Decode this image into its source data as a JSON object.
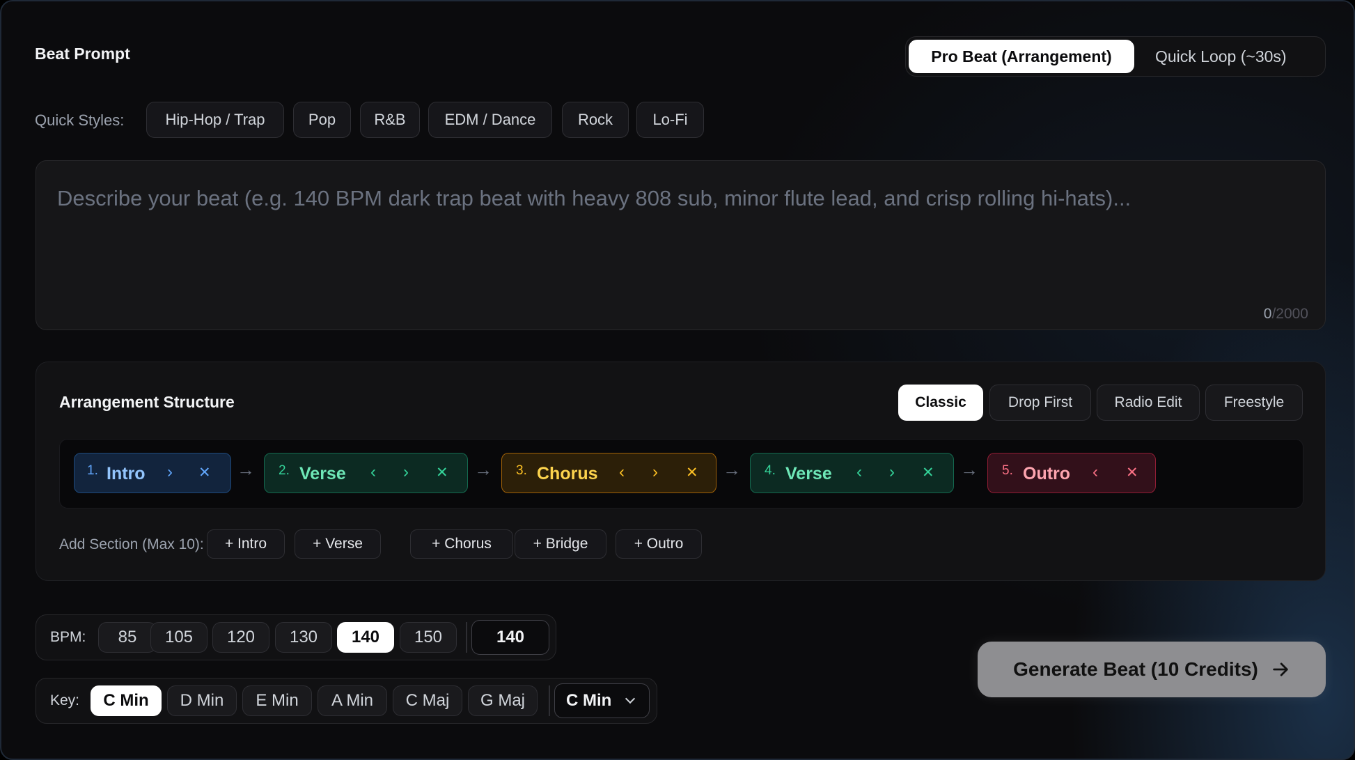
{
  "header": {
    "title": "Beat Prompt",
    "modes": [
      {
        "label": "Pro Beat (Arrangement)",
        "active": true
      },
      {
        "label": "Quick Loop (~30s)",
        "active": false
      }
    ]
  },
  "quick_styles": {
    "label": "Quick Styles:",
    "items": [
      "Hip-Hop / Trap",
      "Pop",
      "R&B",
      "EDM / Dance",
      "Rock",
      "Lo-Fi"
    ]
  },
  "prompt": {
    "placeholder": "Describe your beat (e.g. 140 BPM dark trap beat with heavy 808 sub, minor flute lead, and crisp rolling hi-hats)...",
    "count_current": "0",
    "count_max": "/2000"
  },
  "arrangement": {
    "title": "Arrangement Structure",
    "presets": [
      {
        "label": "Classic",
        "active": true
      },
      {
        "label": "Drop First",
        "active": false
      },
      {
        "label": "Radio Edit",
        "active": false
      },
      {
        "label": "Freestyle",
        "active": false
      }
    ],
    "sections": [
      {
        "num": "1.",
        "name": "Intro",
        "color": "blue"
      },
      {
        "num": "2.",
        "name": "Verse",
        "color": "green"
      },
      {
        "num": "3.",
        "name": "Chorus",
        "color": "yellow"
      },
      {
        "num": "4.",
        "name": "Verse",
        "color": "green"
      },
      {
        "num": "5.",
        "name": "Outro",
        "color": "red"
      }
    ],
    "glyphs": {
      "prev": "‹",
      "next": "›",
      "remove": "✕",
      "flow": "→"
    },
    "add_label": "Add Section (Max 10):",
    "add_buttons": [
      "+ Intro",
      "+ Verse",
      "+ Chorus",
      "+ Bridge",
      "+ Outro"
    ]
  },
  "bpm": {
    "label": "BPM:",
    "options": [
      "85",
      "105",
      "120",
      "130",
      "140",
      "150"
    ],
    "selected": "140",
    "input_value": "140"
  },
  "key": {
    "label": "Key:",
    "options": [
      "C Min",
      "D Min",
      "E Min",
      "A Min",
      "C Maj",
      "G Maj"
    ],
    "selected": "C Min",
    "select_value": "C Min"
  },
  "generate": {
    "label": "Generate Beat (10 Credits)"
  },
  "colors": {
    "accent_blue": "#60a5fa",
    "accent_green": "#34d399",
    "accent_yellow": "#fbbf24",
    "accent_red": "#fb7185"
  }
}
